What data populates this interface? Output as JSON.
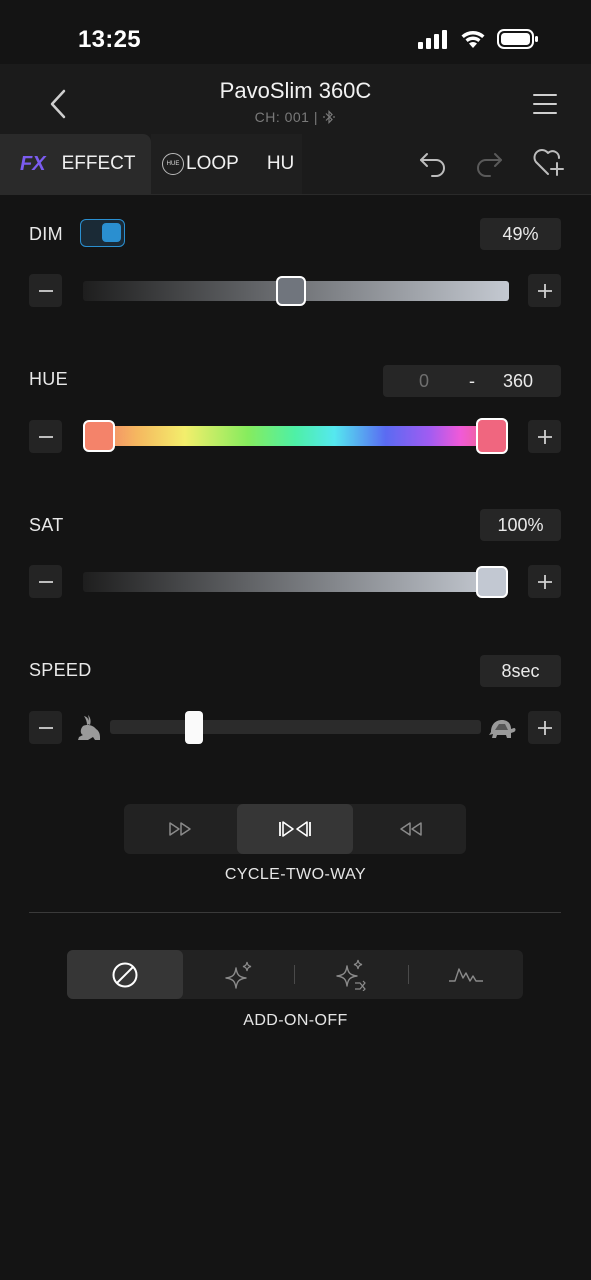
{
  "status": {
    "time": "13:25"
  },
  "header": {
    "title": "PavoSlim 360C",
    "subtitle": "CH: 001  |"
  },
  "tabs": [
    {
      "icon": "fx-icon",
      "fx_text": "FX",
      "label": "EFFECT"
    },
    {
      "icon": "hue-loop-icon",
      "icon_text": "HUE",
      "label": "LOOP"
    },
    {
      "label": "HU"
    }
  ],
  "dim": {
    "label": "DIM",
    "value": "49%",
    "level": 0.49
  },
  "hue": {
    "label": "HUE",
    "min": "0",
    "separator": "-",
    "max": "360"
  },
  "sat": {
    "label": "SAT",
    "value": "100%",
    "level": 1.0
  },
  "speed": {
    "label": "SPEED",
    "value": "8sec"
  },
  "direction": {
    "selected": "CYCLE-TWO-WAY"
  },
  "addon": {
    "selected": "ADD-ON-OFF"
  },
  "colors": {
    "accent": "#2a8fd0",
    "hue_start": "#f4836a",
    "hue_end": "#f0667f"
  }
}
